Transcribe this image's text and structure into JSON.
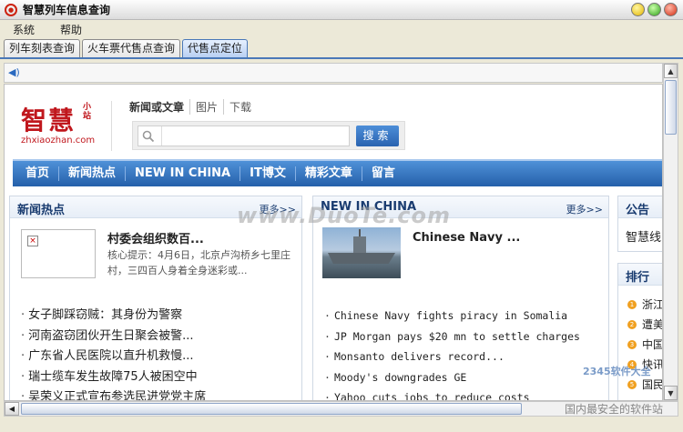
{
  "window": {
    "title": "智慧列车信息查询"
  },
  "menu": [
    "系统",
    "帮助"
  ],
  "tabs": [
    {
      "label": "列车刻表查询",
      "active": false
    },
    {
      "label": "火车票代售点查询",
      "active": false
    },
    {
      "label": "代售点定位",
      "active": true
    }
  ],
  "logo": {
    "main": "智慧",
    "small": "小站",
    "url": "zhxiaozhan.com"
  },
  "search": {
    "tabs": [
      "新闻或文章",
      "图片",
      "下载"
    ],
    "placeholder": "",
    "button": "搜索"
  },
  "nav": [
    "首页",
    "新闻热点",
    "NEW IN CHINA",
    "IT博文",
    "精彩文章",
    "留言"
  ],
  "panel_news": {
    "title": "新闻热点",
    "more": "更多>>",
    "feature_title": "村委会组织数百...",
    "feature_desc": "核心提示：4月6日，北京卢沟桥乡七里庄村，三四百人身着全身迷彩或...",
    "items": [
      "女子脚踩窃贼：其身份为警察",
      "河南盗窃团伙开生日聚会被警...",
      "广东省人民医院以直升机救慢...",
      "瑞士缆车发生故障75人被困空中",
      "吴荣义正式宣布参选民进党党主席"
    ]
  },
  "panel_china": {
    "title": "NEW IN CHINA",
    "more": "更多>>",
    "feature_title": "Chinese Navy ...",
    "items": [
      "Chinese Navy fights piracy in Somalia",
      "JP Morgan pays $20 mn to settle charges",
      "Monsanto delivers record...",
      "Moody's downgrades GE",
      "Yahoo cuts jobs to reduce costs"
    ]
  },
  "panel_notice": {
    "title": "公告",
    "text": "智慧线"
  },
  "panel_rank": {
    "title": "排行",
    "items": [
      "浙江",
      "遭美",
      "中国",
      "快讯",
      "国民"
    ]
  },
  "watermark": {
    "main": "www.DuoTe.com",
    "bottom": "国内最安全的软件站",
    "logo": "2345软件大全"
  },
  "colors": {
    "accent": "#2a63b0",
    "brand": "#c0171d"
  }
}
